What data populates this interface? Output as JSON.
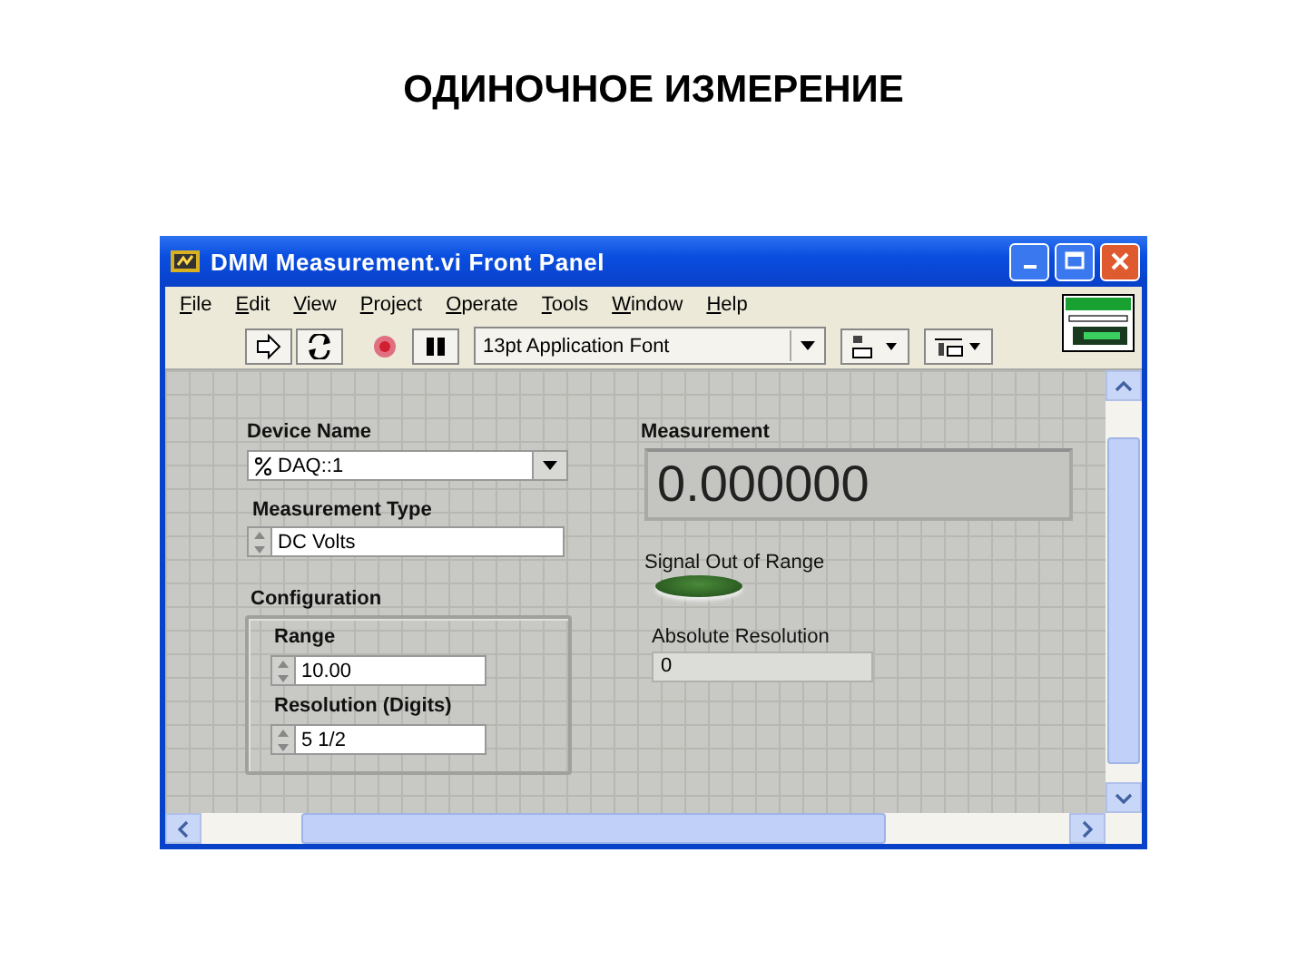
{
  "slide_title": "ОДИНОЧНОЕ ИЗМЕРЕНИЕ",
  "window": {
    "title": "DMM Measurement.vi Front Panel",
    "menu": [
      "File",
      "Edit",
      "View",
      "Project",
      "Operate",
      "Tools",
      "Window",
      "Help"
    ],
    "toolbar": {
      "font": "13pt Application Font"
    }
  },
  "panel": {
    "device_name": {
      "label": "Device Name",
      "value": "DAQ::1"
    },
    "measurement_type": {
      "label": "Measurement Type",
      "value": "DC Volts"
    },
    "configuration": {
      "label": "Configuration",
      "range": {
        "label": "Range",
        "value": "10.00"
      },
      "resolution": {
        "label": "Resolution (Digits)",
        "value": "5 1/2"
      }
    },
    "measurement": {
      "label": "Measurement",
      "value": "0.000000"
    },
    "signal_out_of_range": {
      "label": "Signal Out of Range",
      "on": false
    },
    "absolute_resolution": {
      "label": "Absolute Resolution",
      "value": "0"
    }
  }
}
